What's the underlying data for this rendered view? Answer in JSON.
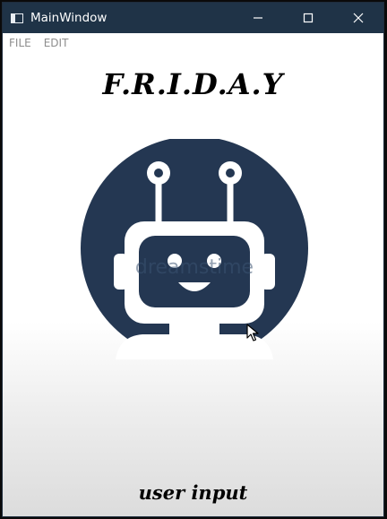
{
  "window": {
    "title": "MainWindow",
    "controls": {
      "minimize_icon": "minimize-icon",
      "maximize_icon": "maximize-icon",
      "close_icon": "close-icon"
    }
  },
  "menu": {
    "items": [
      "FILE",
      "EDIT"
    ]
  },
  "main": {
    "app_title": "F.R.I.D.A.Y",
    "logo_icon": "robot-icon",
    "watermark": "dreamstime",
    "user_input_label": "user input"
  },
  "colors": {
    "titlebar": "#1f3347",
    "logo": "#243752",
    "menu_text": "#8d8d8d"
  }
}
